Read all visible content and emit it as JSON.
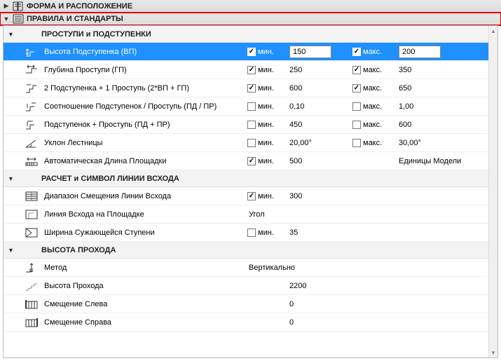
{
  "headers": {
    "h1": "ФОРМА И РАСПОЛОЖЕНИЕ",
    "h2": "ПРАВИЛА И СТАНДАРТЫ"
  },
  "sections": {
    "s1": {
      "title": "ПРОСТУПИ и ПОДСТУПЕНКИ"
    },
    "s2": {
      "title": "РАСЧЕТ и СИМВОЛ ЛИНИИ ВСХОДА"
    },
    "s3": {
      "title": "ВЫСОТА ПРОХОДА"
    }
  },
  "labels": {
    "min": "мин.",
    "max": "макс."
  },
  "rows": {
    "r1": {
      "name": "Высота Подступенка (ВП)",
      "minChecked": true,
      "minVal": "150",
      "maxChecked": true,
      "maxVal": "200"
    },
    "r2": {
      "name": "Глубина Проступи (ГП)",
      "minChecked": true,
      "minVal": "250",
      "maxChecked": true,
      "maxVal": "350"
    },
    "r3": {
      "name": "2 Подступенка + 1 Проступь (2*ВП + ГП)",
      "minChecked": true,
      "minVal": "600",
      "maxChecked": true,
      "maxVal": "650"
    },
    "r4": {
      "name": "Соотношение Подступенок / Проступь (ПД / ПР)",
      "minChecked": false,
      "minVal": "0,10",
      "maxChecked": false,
      "maxVal": "1,00"
    },
    "r5": {
      "name": "Подступенок + Проступь (ПД + ПР)",
      "minChecked": false,
      "minVal": "450",
      "maxChecked": false,
      "maxVal": "600"
    },
    "r6": {
      "name": "Уклон Лестницы",
      "minChecked": false,
      "minVal": "20,00°",
      "maxChecked": false,
      "maxVal": "30,00°"
    },
    "r7": {
      "name": "Автоматическая Длина Площадки",
      "minChecked": true,
      "minVal": "500",
      "maxText": "Единицы Модели"
    },
    "r8": {
      "name": "Диапазон Смещения Линии Всхода",
      "minChecked": true,
      "minVal": "300"
    },
    "r9": {
      "name": "Линия Всхода на Площадке",
      "plain": "Угол"
    },
    "r10": {
      "name": "Ширина Сужающейся Ступени",
      "minChecked": false,
      "minVal": "35"
    },
    "r11": {
      "name": "Метод",
      "plain": "Вертикально"
    },
    "r12": {
      "name": "Высота Прохода",
      "value": "2200"
    },
    "r13": {
      "name": "Смещение Слева",
      "value": "0"
    },
    "r14": {
      "name": "Смещение Справа",
      "value": "0"
    }
  }
}
